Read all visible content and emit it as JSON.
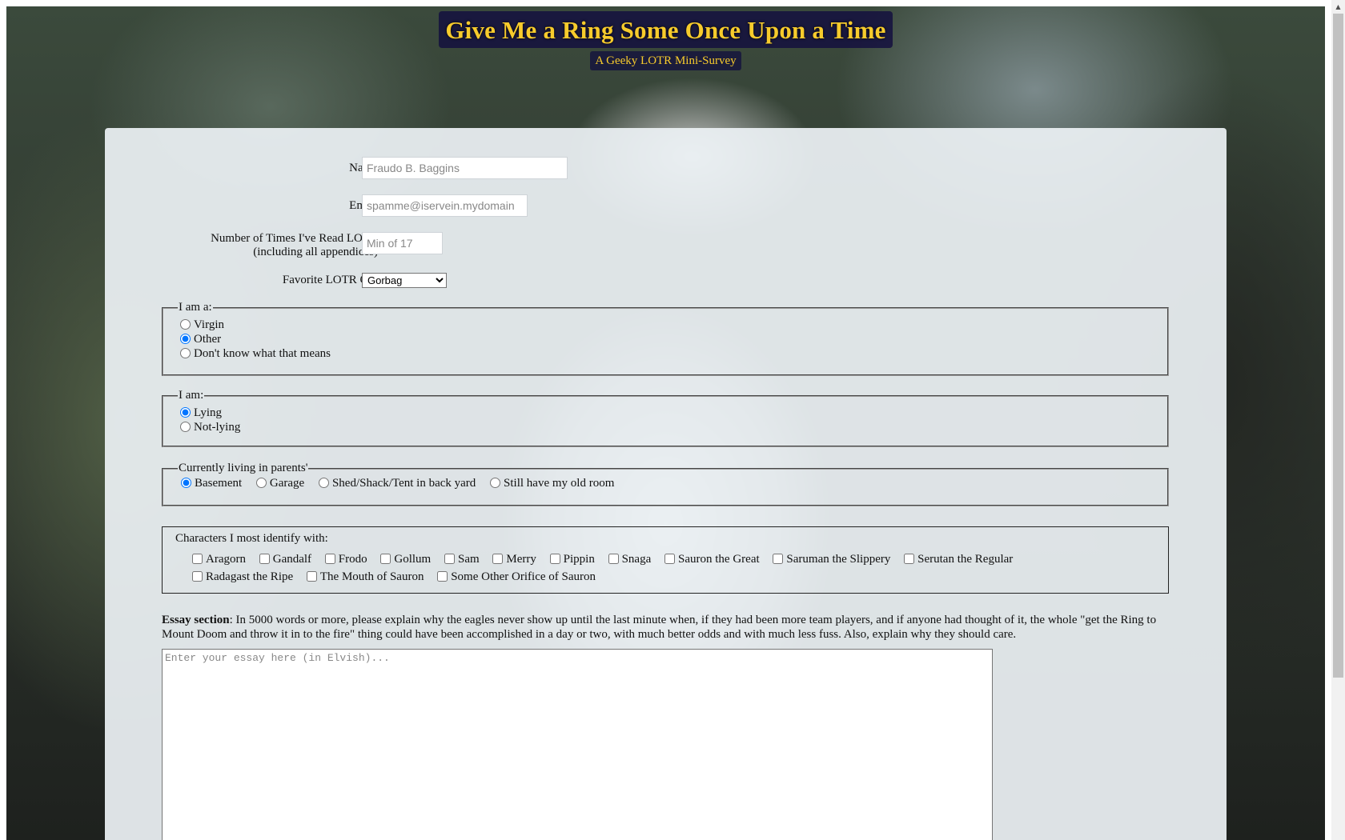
{
  "header": {
    "title": "Give Me a Ring Some Once Upon a Time",
    "subtitle": "A Geeky LOTR Mini-Survey"
  },
  "form": {
    "name_label": "Name",
    "name_placeholder": "Fraudo B. Baggins",
    "email_label": "Email",
    "email_placeholder": "spamme@iservein.mydomain",
    "times_read_label_line1": "Number of Times I've Read LOTR",
    "times_read_label_line2": "(including all appendices)",
    "times_read_placeholder": "Min of 17",
    "orc_label": "Favorite LOTR Orc",
    "orc_selected": "Gorbag",
    "i_am_a": {
      "legend": "I am a:",
      "options": [
        "Virgin",
        "Other",
        "Don't know what that means"
      ],
      "selected": "Other"
    },
    "i_am": {
      "legend": "I am:",
      "options": [
        "Lying",
        "Not-lying"
      ],
      "selected": "Lying"
    },
    "living": {
      "legend": "Currently living in parents'",
      "options": [
        "Basement",
        "Garage",
        "Shed/Shack/Tent in back yard",
        "Still have my old room"
      ],
      "selected": "Basement"
    },
    "characters": {
      "heading": "Characters I most identify with:",
      "options": [
        "Aragorn",
        "Gandalf",
        "Frodo",
        "Gollum",
        "Sam",
        "Merry",
        "Pippin",
        "Snaga",
        "Sauron the Great",
        "Saruman the Slippery",
        "Serutan the Regular",
        "Radagast the Ripe",
        "The Mouth of Sauron",
        "Some Other Orifice of Sauron"
      ]
    },
    "essay": {
      "label_bold": "Essay section",
      "label_text": ": In 5000 words or more, please explain why the eagles never show up until the last minute when, if they had been more team players, and if anyone had thought of it, the whole \"get the Ring to Mount Doom and throw it in to the fire\" thing could have been accomplished in a day or two, with much better odds and with much less fuss. Also, explain why they should care.",
      "placeholder": "Enter your essay here (in Elvish)..."
    }
  }
}
